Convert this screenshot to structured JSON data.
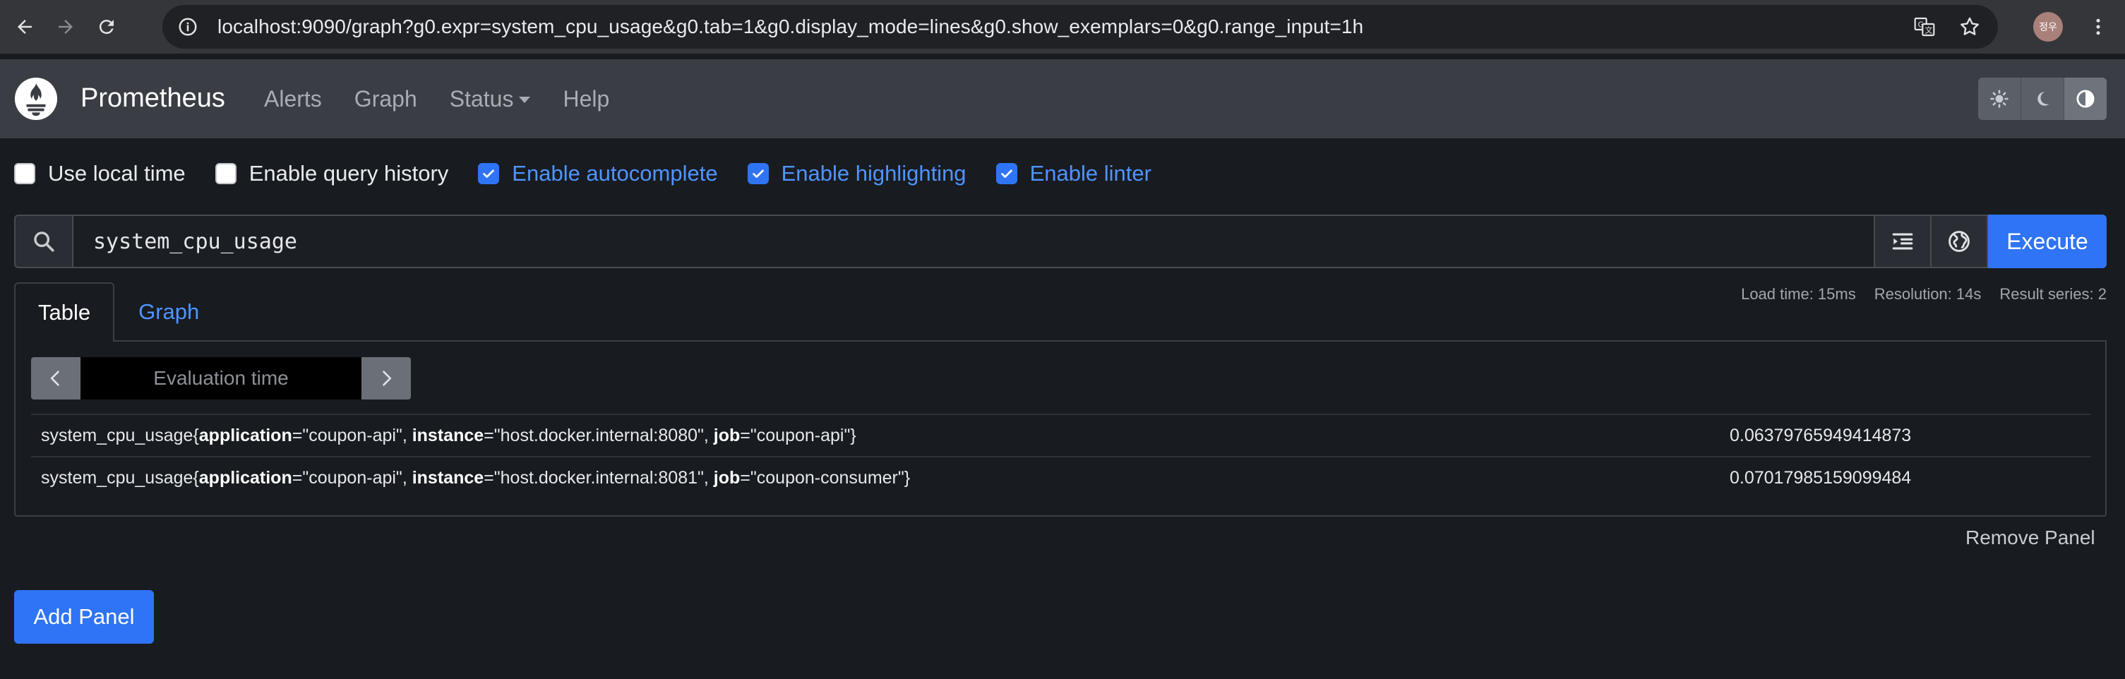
{
  "browser": {
    "url": "localhost:9090/graph?g0.expr=system_cpu_usage&g0.tab=1&g0.display_mode=lines&g0.show_exemplars=0&g0.range_input=1h",
    "avatar_text": "정우"
  },
  "navbar": {
    "brand": "Prometheus",
    "links": [
      {
        "label": "Alerts"
      },
      {
        "label": "Graph"
      },
      {
        "label": "Status"
      },
      {
        "label": "Help"
      }
    ]
  },
  "options": [
    {
      "label": "Use local time",
      "checked": false
    },
    {
      "label": "Enable query history",
      "checked": false
    },
    {
      "label": "Enable autocomplete",
      "checked": true
    },
    {
      "label": "Enable highlighting",
      "checked": true
    },
    {
      "label": "Enable linter",
      "checked": true
    }
  ],
  "query": {
    "expression": "system_cpu_usage",
    "execute_label": "Execute"
  },
  "tabs": [
    {
      "label": "Table",
      "active": true
    },
    {
      "label": "Graph",
      "active": false
    }
  ],
  "stats": {
    "load_time": "Load time: 15ms",
    "resolution": "Resolution: 14s",
    "result_series": "Result series: 2"
  },
  "evaluation": {
    "placeholder": "Evaluation time"
  },
  "results": [
    {
      "metric_name": "system_cpu_usage",
      "labels": [
        {
          "key": "application",
          "value": "\"coupon-api\""
        },
        {
          "key": "instance",
          "value": "\"host.docker.internal:8080\""
        },
        {
          "key": "job",
          "value": "\"coupon-api\""
        }
      ],
      "value": "0.06379765949414873"
    },
    {
      "metric_name": "system_cpu_usage",
      "labels": [
        {
          "key": "application",
          "value": "\"coupon-api\""
        },
        {
          "key": "instance",
          "value": "\"host.docker.internal:8081\""
        },
        {
          "key": "job",
          "value": "\"coupon-consumer\""
        }
      ],
      "value": "0.07017985159099484"
    }
  ],
  "actions": {
    "remove_panel": "Remove Panel",
    "add_panel": "Add Panel"
  },
  "colors": {
    "accent": "#2f74f5",
    "link": "#4f94ff",
    "background": "#181b20",
    "navbar": "#3a3e44"
  }
}
